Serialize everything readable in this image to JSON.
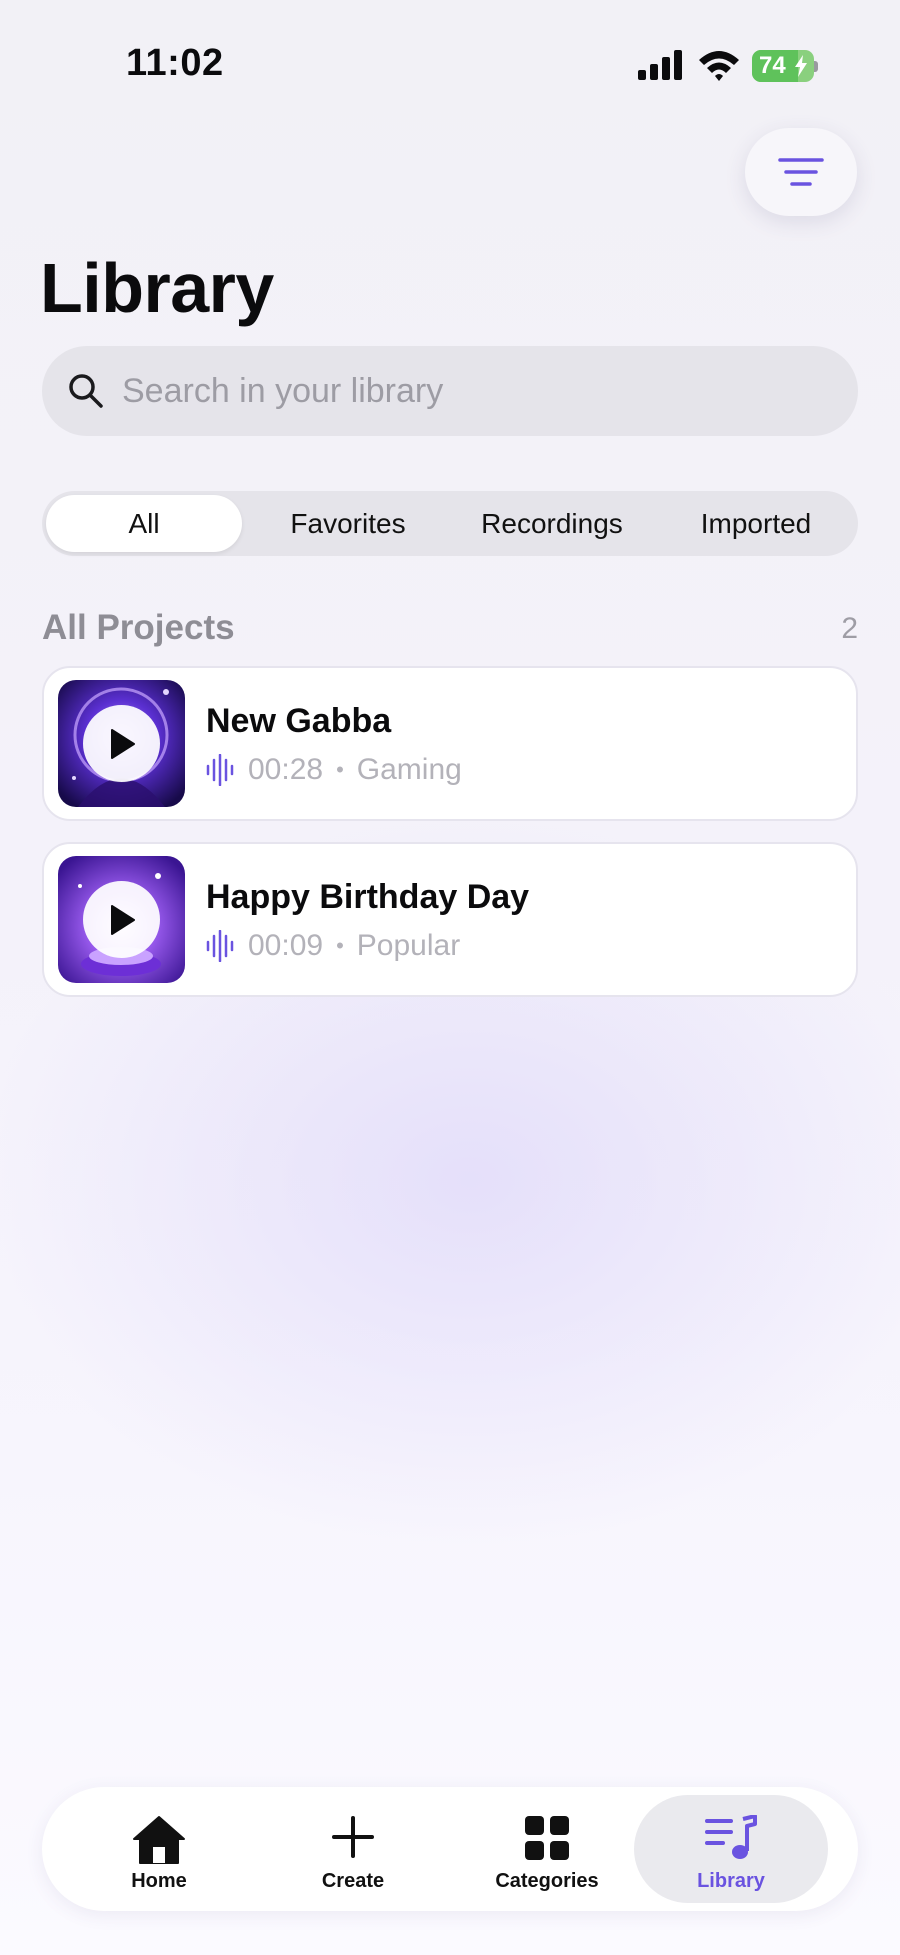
{
  "status_bar": {
    "time": "11:02",
    "battery": "74"
  },
  "header": {
    "title": "Library",
    "filter_icon": "filter-lines-icon"
  },
  "search": {
    "placeholder": "Search in your library",
    "icon": "search-icon"
  },
  "segments": [
    {
      "label": "All",
      "active": true
    },
    {
      "label": "Favorites",
      "active": false
    },
    {
      "label": "Recordings",
      "active": false
    },
    {
      "label": "Imported",
      "active": false
    }
  ],
  "section": {
    "title": "All Projects",
    "count": "2"
  },
  "projects": [
    {
      "title": "New Gabba",
      "duration": "00:28",
      "category": "Gaming"
    },
    {
      "title": "Happy Birthday Day",
      "duration": "00:09",
      "category": "Popular"
    }
  ],
  "tab_bar": {
    "tabs": [
      {
        "label": "Home",
        "icon": "home-icon",
        "active": false
      },
      {
        "label": "Create",
        "icon": "plus-icon",
        "active": false
      },
      {
        "label": "Categories",
        "icon": "grid-icon",
        "active": false
      },
      {
        "label": "Library",
        "icon": "music-library-icon",
        "active": true
      }
    ]
  },
  "colors": {
    "accent": "#6a53e0",
    "background": "#f2f1f6",
    "battery": "#5fc25b"
  }
}
